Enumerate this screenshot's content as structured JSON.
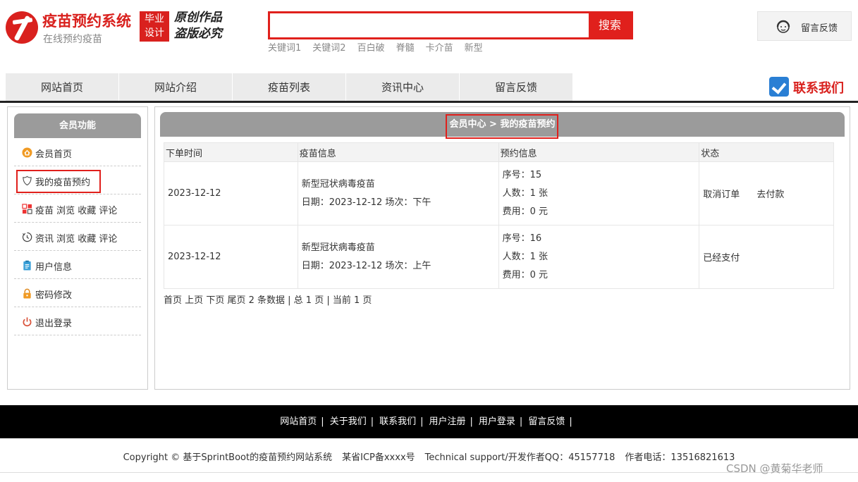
{
  "header": {
    "site_title": "疫苗预约系统",
    "site_subtitle": "在线预约疫苗",
    "badge_line1": "毕业",
    "badge_line2": "设计",
    "original_line1": "原创作品",
    "original_line2": "盗版必究",
    "search_placeholder": "",
    "search_value": "",
    "search_button": "搜索",
    "keywords": [
      "关键词1",
      "关键词2",
      "百白破",
      "脊髓",
      "卡介苗",
      "新型"
    ],
    "feedback_label": "留言反馈"
  },
  "nav": {
    "items": [
      "网站首页",
      "网站介绍",
      "疫苗列表",
      "资讯中心",
      "留言反馈"
    ],
    "contact_label": "联系我们"
  },
  "sidebar": {
    "title": "会员功能",
    "items": [
      {
        "label": "会员首页",
        "icon": "home-icon"
      },
      {
        "label": "我的疫苗预约",
        "icon": "shield-icon"
      },
      {
        "label": "疫苗 浏览 收藏 评论",
        "icon": "grid-icon"
      },
      {
        "label": "资讯 浏览 收藏 评论",
        "icon": "clock-icon"
      },
      {
        "label": "用户信息",
        "icon": "clipboard-icon"
      },
      {
        "label": "密码修改",
        "icon": "lock-icon"
      },
      {
        "label": "退出登录",
        "icon": "power-icon"
      }
    ]
  },
  "main": {
    "breadcrumb": "会员中心 > 我的疫苗预约",
    "table": {
      "headers": [
        "下单时间",
        "疫苗信息",
        "预约信息",
        "状态"
      ],
      "rows": [
        {
          "order_time": "2023-12-12",
          "vaccine_name": "新型冠状病毒疫苗",
          "vaccine_date": "日期：2023-12-12 场次：下午",
          "seq": "序号：15",
          "people": "人数：1 张",
          "fee": "费用：0 元",
          "actions": [
            "取消订单",
            "去付款"
          ]
        },
        {
          "order_time": "2023-12-12",
          "vaccine_name": "新型冠状病毒疫苗",
          "vaccine_date": "日期：2023-12-12 场次：上午",
          "seq": "序号：16",
          "people": "人数：1 张",
          "fee": "费用：0 元",
          "status": "已经支付"
        }
      ]
    },
    "pager": {
      "first": "首页",
      "prev": "上页",
      "next": "下页",
      "last": "尾页",
      "info": "2 条数据 | 总 1 页 | 当前 1 页"
    }
  },
  "footer": {
    "links": [
      "网站首页",
      "关于我们",
      "联系我们",
      "用户注册",
      "用户登录",
      "留言反馈"
    ],
    "separator": "|",
    "copyright": "Copyright © 基于SprintBoot的疫苗预约网站系统",
    "icp": "某省ICP备xxxx号",
    "support": "Technical support/开发作者QQ：45157718",
    "phone": "作者电话：13516821613",
    "watermark": "CSDN @黄菊华老师"
  },
  "colors": {
    "brand_red": "#d9211e",
    "search_red": "#e0201c",
    "panel_gray": "#9b9b9b",
    "nav_gray": "#ebebeb",
    "footer_black": "#000000"
  }
}
